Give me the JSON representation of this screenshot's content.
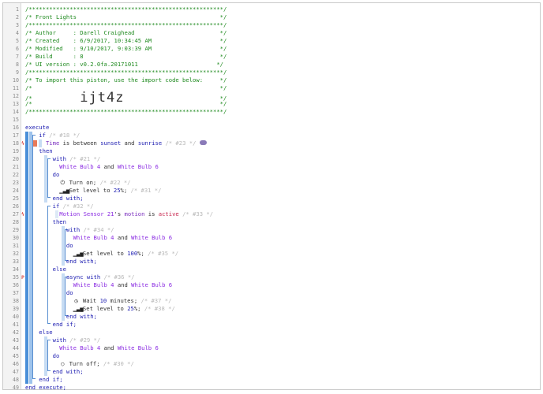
{
  "editor": {
    "lines": [
      {
        "n": "1",
        "mk": "",
        "tokens": [
          {
            "t": "/*********************************************************/",
            "c": "c"
          }
        ]
      },
      {
        "n": "2",
        "mk": "",
        "tokens": [
          {
            "t": "/* Front Lights                                          */",
            "c": "c"
          }
        ]
      },
      {
        "n": "3",
        "mk": "",
        "tokens": [
          {
            "t": "/*********************************************************/",
            "c": "c"
          }
        ]
      },
      {
        "n": "4",
        "mk": "",
        "tokens": [
          {
            "t": "/* Author     : Darell Craighead                         */",
            "c": "c"
          }
        ]
      },
      {
        "n": "5",
        "mk": "",
        "tokens": [
          {
            "t": "/* Created    : 6/9/2017, 10:34:45 AM                    */",
            "c": "c"
          }
        ]
      },
      {
        "n": "6",
        "mk": "",
        "tokens": [
          {
            "t": "/* Modified   : 9/10/2017, 9:03:39 AM                    */",
            "c": "c"
          }
        ]
      },
      {
        "n": "7",
        "mk": "",
        "tokens": [
          {
            "t": "/* Build      : 8                                        */",
            "c": "c"
          }
        ]
      },
      {
        "n": "8",
        "mk": "",
        "tokens": [
          {
            "t": "/* UI version : v0.2.0fa.20171011                       */",
            "c": "c"
          }
        ]
      },
      {
        "n": "9",
        "mk": "",
        "tokens": [
          {
            "t": "/*********************************************************/",
            "c": "c"
          }
        ]
      },
      {
        "n": "10",
        "mk": "",
        "tokens": [
          {
            "t": "/* To import this piston, use the import code below:     */",
            "c": "c"
          }
        ]
      },
      {
        "n": "11",
        "mk": "",
        "tokens": [
          {
            "t": "/*                                                       */",
            "c": "c"
          }
        ]
      },
      {
        "n": "12",
        "mk": "",
        "tokens": [
          {
            "t": "/*              ",
            "c": "c"
          },
          {
            "t": "ijt4z",
            "c": "big"
          },
          {
            "t": "                            */",
            "c": "c"
          }
        ]
      },
      {
        "n": "13",
        "mk": "",
        "tokens": [
          {
            "t": "/*                                                       */",
            "c": "c"
          }
        ]
      },
      {
        "n": "14",
        "mk": "",
        "tokens": [
          {
            "t": "/*********************************************************/",
            "c": "c"
          }
        ]
      },
      {
        "n": "15",
        "mk": "",
        "tokens": []
      },
      {
        "n": "16",
        "mk": "",
        "tokens": [
          {
            "t": "execute",
            "c": "k"
          }
        ]
      },
      {
        "n": "17",
        "mk": "",
        "tokens": [
          {
            "t": "    if ",
            "c": "k"
          },
          {
            "t": "/* #18 */",
            "c": "cm"
          }
        ]
      },
      {
        "n": "18",
        "mk": "ϟ",
        "tokens": [
          {
            "t": "      Time ",
            "c": "v"
          },
          {
            "t": "is between ",
            "c": ""
          },
          {
            "t": "sunset",
            "c": "k"
          },
          {
            "t": " and ",
            "c": ""
          },
          {
            "t": "sunrise",
            "c": "k"
          },
          {
            "t": " /* #23 */ ",
            "c": "cm"
          },
          {
            "t": "pill",
            "c": "pill"
          }
        ]
      },
      {
        "n": "19",
        "mk": "",
        "tokens": [
          {
            "t": "    then",
            "c": "k"
          }
        ]
      },
      {
        "n": "20",
        "mk": "",
        "tokens": [
          {
            "t": "        with ",
            "c": "k"
          },
          {
            "t": "/* #21 */",
            "c": "cm"
          }
        ]
      },
      {
        "n": "21",
        "mk": "",
        "tokens": [
          {
            "t": "          White Bulb 4",
            "c": "d"
          },
          {
            "t": " and ",
            "c": ""
          },
          {
            "t": "White Bulb 6",
            "c": "d"
          }
        ]
      },
      {
        "n": "22",
        "mk": "",
        "tokens": [
          {
            "t": "        do",
            "c": "k"
          }
        ]
      },
      {
        "n": "23",
        "mk": "",
        "tokens": [
          {
            "t": "          ",
            "c": ""
          },
          {
            "t": "⏻",
            "c": "ic"
          },
          {
            "t": " Turn on; ",
            "c": ""
          },
          {
            "t": "/* #22 */",
            "c": "cm"
          }
        ]
      },
      {
        "n": "24",
        "mk": "",
        "tokens": [
          {
            "t": "          ",
            "c": ""
          },
          {
            "t": "▁▃▅",
            "c": "ic"
          },
          {
            "t": " Set level to ",
            "c": ""
          },
          {
            "t": "25",
            "c": "n"
          },
          {
            "t": "%; ",
            "c": ""
          },
          {
            "t": "/* #31 */",
            "c": "cm"
          }
        ]
      },
      {
        "n": "25",
        "mk": "",
        "tokens": [
          {
            "t": "        end with;",
            "c": "k"
          }
        ]
      },
      {
        "n": "26",
        "mk": "",
        "tokens": [
          {
            "t": "        if ",
            "c": "k"
          },
          {
            "t": "/* #32 */",
            "c": "cm"
          }
        ]
      },
      {
        "n": "27",
        "mk": "ϟ",
        "tokens": [
          {
            "t": "          Motion Sensor 21",
            "c": "d"
          },
          {
            "t": "'s ",
            "c": ""
          },
          {
            "t": "motion",
            "c": "v"
          },
          {
            "t": " is ",
            "c": ""
          },
          {
            "t": "active",
            "c": "s"
          },
          {
            "t": " /* #33 */",
            "c": "cm"
          }
        ]
      },
      {
        "n": "28",
        "mk": "",
        "tokens": [
          {
            "t": "        then",
            "c": "k"
          }
        ]
      },
      {
        "n": "29",
        "mk": "",
        "tokens": [
          {
            "t": "            with ",
            "c": "k"
          },
          {
            "t": "/* #34 */",
            "c": "cm"
          }
        ]
      },
      {
        "n": "30",
        "mk": "",
        "tokens": [
          {
            "t": "              White Bulb 4",
            "c": "d"
          },
          {
            "t": " and ",
            "c": ""
          },
          {
            "t": "White Bulb 6",
            "c": "d"
          }
        ]
      },
      {
        "n": "31",
        "mk": "",
        "tokens": [
          {
            "t": "            do",
            "c": "k"
          }
        ]
      },
      {
        "n": "32",
        "mk": "",
        "tokens": [
          {
            "t": "              ",
            "c": ""
          },
          {
            "t": "▁▃▅",
            "c": "ic"
          },
          {
            "t": " Set level to ",
            "c": ""
          },
          {
            "t": "100",
            "c": "n"
          },
          {
            "t": "%; ",
            "c": ""
          },
          {
            "t": "/* #35 */",
            "c": "cm"
          }
        ]
      },
      {
        "n": "33",
        "mk": "",
        "tokens": [
          {
            "t": "            end with;",
            "c": "k"
          }
        ]
      },
      {
        "n": "34",
        "mk": "",
        "tokens": [
          {
            "t": "        else",
            "c": "k"
          }
        ]
      },
      {
        "n": "35",
        "mk": "P",
        "tokens": [
          {
            "t": "            async with ",
            "c": "k"
          },
          {
            "t": "/* #36 */",
            "c": "cm"
          }
        ]
      },
      {
        "n": "36",
        "mk": "",
        "tokens": [
          {
            "t": "              White Bulb 4",
            "c": "d"
          },
          {
            "t": " and ",
            "c": ""
          },
          {
            "t": "White Bulb 6",
            "c": "d"
          }
        ]
      },
      {
        "n": "37",
        "mk": "",
        "tokens": [
          {
            "t": "            do",
            "c": "k"
          }
        ]
      },
      {
        "n": "38",
        "mk": "",
        "tokens": [
          {
            "t": "              ",
            "c": ""
          },
          {
            "t": "◷",
            "c": "ic"
          },
          {
            "t": " Wait ",
            "c": ""
          },
          {
            "t": "10",
            "c": "n"
          },
          {
            "t": " minutes; ",
            "c": ""
          },
          {
            "t": "/* #37 */",
            "c": "cm"
          }
        ]
      },
      {
        "n": "39",
        "mk": "",
        "tokens": [
          {
            "t": "              ",
            "c": ""
          },
          {
            "t": "▁▃▅",
            "c": "ic"
          },
          {
            "t": " Set level to ",
            "c": ""
          },
          {
            "t": "25",
            "c": "n"
          },
          {
            "t": "%; ",
            "c": ""
          },
          {
            "t": "/* #38 */",
            "c": "cm"
          }
        ]
      },
      {
        "n": "40",
        "mk": "",
        "tokens": [
          {
            "t": "            end with;",
            "c": "k"
          }
        ]
      },
      {
        "n": "41",
        "mk": "",
        "tokens": [
          {
            "t": "        end if;",
            "c": "k"
          }
        ]
      },
      {
        "n": "42",
        "mk": "",
        "tokens": [
          {
            "t": "    else",
            "c": "k"
          }
        ]
      },
      {
        "n": "43",
        "mk": "",
        "tokens": [
          {
            "t": "        with ",
            "c": "k"
          },
          {
            "t": "/* #29 */",
            "c": "cm"
          }
        ]
      },
      {
        "n": "44",
        "mk": "",
        "tokens": [
          {
            "t": "          White Bulb 4",
            "c": "d"
          },
          {
            "t": " and ",
            "c": ""
          },
          {
            "t": "White Bulb 6",
            "c": "d"
          }
        ]
      },
      {
        "n": "45",
        "mk": "",
        "tokens": [
          {
            "t": "        do",
            "c": "k"
          }
        ]
      },
      {
        "n": "46",
        "mk": "",
        "tokens": [
          {
            "t": "          ",
            "c": ""
          },
          {
            "t": "○",
            "c": "ic"
          },
          {
            "t": " Turn off; ",
            "c": ""
          },
          {
            "t": "/* #30 */",
            "c": "cm"
          }
        ]
      },
      {
        "n": "47",
        "mk": "",
        "tokens": [
          {
            "t": "        end with;",
            "c": "k"
          }
        ]
      },
      {
        "n": "48",
        "mk": "",
        "tokens": [
          {
            "t": "    end if;",
            "c": "k"
          }
        ]
      },
      {
        "n": "49",
        "mk": "",
        "tokens": [
          {
            "t": "end execute;",
            "c": "k"
          }
        ]
      }
    ]
  }
}
